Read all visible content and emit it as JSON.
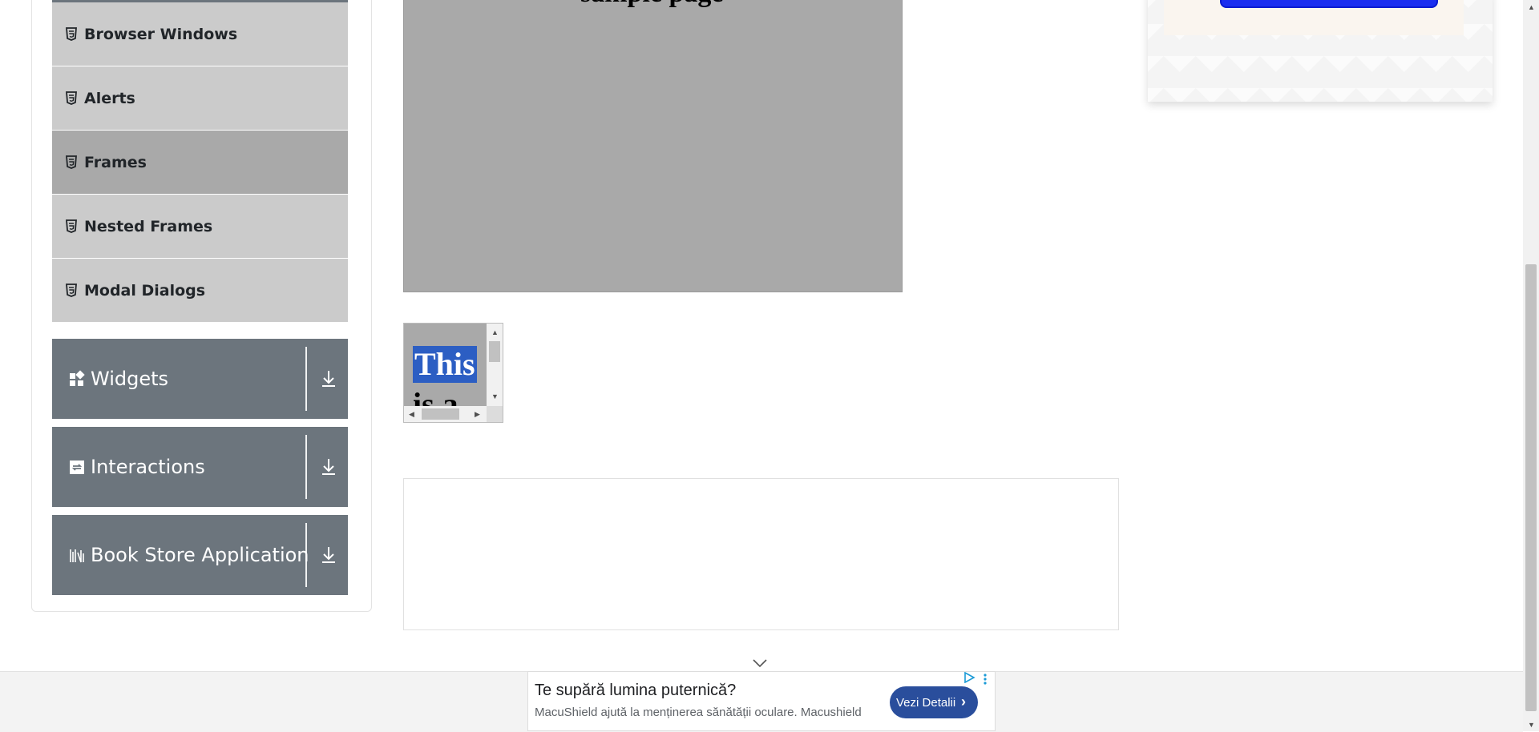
{
  "sidebar": {
    "submenu": [
      {
        "label": "Browser Windows"
      },
      {
        "label": "Alerts"
      },
      {
        "label": "Frames"
      },
      {
        "label": "Nested Frames"
      },
      {
        "label": "Modal Dialogs"
      }
    ],
    "groups": [
      {
        "label": "Widgets",
        "icon": "widgets-icon"
      },
      {
        "label": "Interactions",
        "icon": "interactions-icon"
      },
      {
        "label": "Book Store Application",
        "icon": "books-icon"
      }
    ]
  },
  "frames": {
    "big_heading_partial": "sample page",
    "small_selected_text": "This",
    "small_next_text": "is a"
  },
  "ad": {
    "title": "Te supără lumina puternică?",
    "description": "MacuShield ajută la menținerea sănătății oculare. Macushield",
    "button": "Vezi Detalii"
  },
  "colors": {
    "submenu_bg": "#cbcbcb",
    "submenu_active_bg": "#a9a9a9",
    "group_bg": "#6c757d",
    "selection": "#2c5ec3",
    "ad_button": "#2a4e9c"
  }
}
